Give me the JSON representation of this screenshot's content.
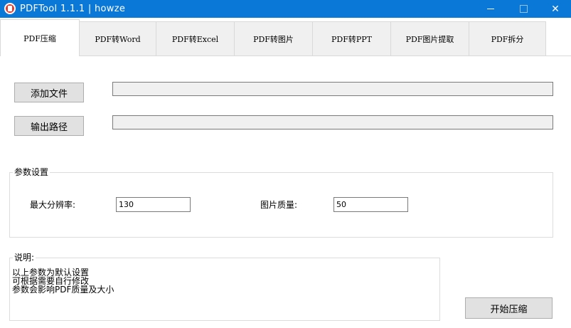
{
  "window": {
    "title": "PDFTool 1.1.1  |  howze",
    "close_glyph": "✕"
  },
  "tabs": [
    {
      "label": "PDF压缩",
      "active": true
    },
    {
      "label": "PDF转Word",
      "active": false
    },
    {
      "label": "PDF转Excel",
      "active": false
    },
    {
      "label": "PDF转图片",
      "active": false
    },
    {
      "label": "PDF转PPT",
      "active": false
    },
    {
      "label": "PDF图片提取",
      "active": false
    },
    {
      "label": "PDF拆分",
      "active": false
    }
  ],
  "file": {
    "add_label": "添加文件",
    "add_value": "",
    "output_label": "输出路径",
    "output_value": ""
  },
  "settings": {
    "group_title": "参数设置",
    "resolution_label": "最大分辨率:",
    "resolution_value": "130",
    "quality_label": "图片质量:",
    "quality_value": "50"
  },
  "notes": {
    "title": "说明:",
    "lines": [
      "以上参数为默认设置",
      "可根据需要自行修改",
      "参数会影响PDF质量及大小"
    ]
  },
  "actions": {
    "start_label": "开始压缩"
  },
  "icons": {
    "app": "pdf-app-icon",
    "minimize": "minimize-icon",
    "maximize": "maximize-icon",
    "close": "close-icon"
  }
}
